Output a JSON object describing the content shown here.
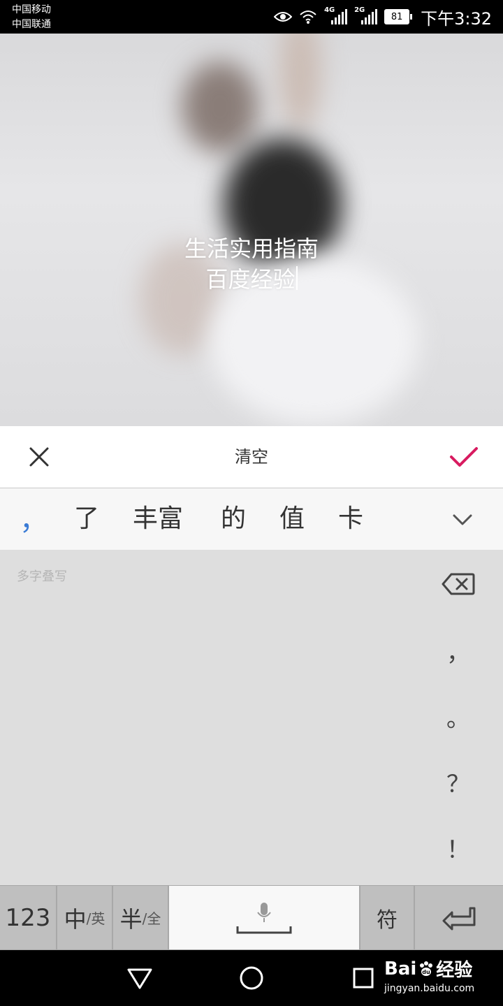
{
  "status_bar": {
    "carrier1": "中国移动",
    "carrier2": "中国联通",
    "net1": "4G",
    "net2": "2G",
    "battery": "81",
    "time": "下午3:32"
  },
  "photo": {
    "line1": "生活实用指南",
    "line2": "百度经验"
  },
  "toolbar": {
    "clear_label": "清空"
  },
  "candidates": {
    "items": [
      "，",
      "了",
      "丰富",
      "的",
      "值",
      "卡"
    ]
  },
  "handwriting": {
    "hint": "多字叠写",
    "punct": [
      "，",
      "。",
      "？",
      "！"
    ]
  },
  "keys": {
    "num": "123",
    "lang_main": "中",
    "lang_sub": "/英",
    "width_main": "半",
    "width_sub": "/全",
    "symbols": "符"
  },
  "watermark": {
    "logo_a": "Bai",
    "logo_b": "经验",
    "url": "jingyan.baidu.com"
  },
  "colors": {
    "accent": "#d81b60",
    "candidate_highlight": "#3a7bd5"
  }
}
